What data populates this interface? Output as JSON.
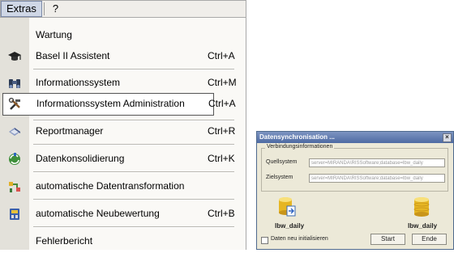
{
  "menubar": {
    "items": [
      "Extras",
      "?"
    ]
  },
  "menu": {
    "items": [
      {
        "label": "Wartung",
        "shortcut": ""
      },
      {
        "label": "Basel II Assistent",
        "shortcut": "Ctrl+A",
        "icon": "mortarboard-icon"
      },
      {
        "label": "Informationssystem",
        "shortcut": "Ctrl+M",
        "icon": "binoculars-icon"
      },
      {
        "label": "Informationssystem Administration",
        "shortcut": "Ctrl+A",
        "icon": "tools-icon"
      },
      {
        "label": "Reportmanager",
        "shortcut": "Ctrl+R",
        "icon": "report-icon"
      },
      {
        "label": "Datenkonsolidierung",
        "shortcut": "Ctrl+K",
        "icon": "sync-icon"
      },
      {
        "label": "automatische Datentransformation",
        "shortcut": "",
        "icon": "transform-icon"
      },
      {
        "label": "automatische Neubewertung",
        "shortcut": "Ctrl+B",
        "icon": "revaluation-icon"
      },
      {
        "label": "Fehlerbericht",
        "shortcut": ""
      }
    ]
  },
  "dialog": {
    "title": "Datensynchronisation ...",
    "group_label": "Verbindungsinformationen",
    "source_label": "Quellsystem",
    "source_value": "server=MIRANDA\\RISSoftware;database=lbw_daily",
    "target_label": "Zielsystem",
    "target_value": "server=MIRANDA\\RISSoftware;database=lbw_daily",
    "source_db": "lbw_daily",
    "target_db": "lbw_daily",
    "checkbox_label": "Daten neu initialisieren",
    "start_label": "Start",
    "end_label": "Ende"
  }
}
